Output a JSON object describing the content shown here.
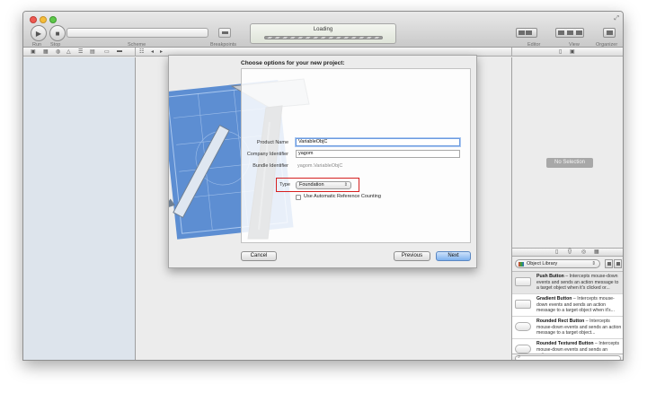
{
  "toolbar": {
    "run_label": "Run",
    "stop_label": "Stop",
    "scheme_label": "Scheme",
    "breakpoints_label": "Breakpoints",
    "activity_text": "Loading",
    "editor_label": "Editor",
    "view_label": "View",
    "organizer_label": "Organizer"
  },
  "inspector": {
    "no_selection": "No Selection"
  },
  "library": {
    "selector": "Object Library",
    "items": [
      {
        "title": "Push Button",
        "text": " – Intercepts mouse-down events and sends an action message to a target object when it's clicked or..."
      },
      {
        "title": "Gradient Button",
        "text": " – Intercepts mouse-down events and sends an action message to a target object when it's..."
      },
      {
        "title": "Rounded Rect Button",
        "text": " – Intercepts mouse-down events and sends an action message to a target object..."
      },
      {
        "title": "Rounded Textured Button",
        "text": " – Intercepts mouse-down events and sends an action..."
      }
    ]
  },
  "sheet": {
    "title": "Choose options for your new project:",
    "product_name_label": "Product Name",
    "product_name_value": "VariableObjC",
    "company_id_label": "Company Identifier",
    "company_id_value": "yagom",
    "bundle_id_label": "Bundle Identifier",
    "bundle_id_value": "yagom.VariableObjC",
    "type_label": "Type",
    "type_value": "Foundation",
    "arc_label": "Use Automatic Reference Counting",
    "cancel": "Cancel",
    "previous": "Previous",
    "next": "Next"
  },
  "colors": {
    "window_bg": "#ececec",
    "navigator_bg": "#dde4ec",
    "highlight_red": "#d62020",
    "default_button": "#7fb2ee"
  }
}
